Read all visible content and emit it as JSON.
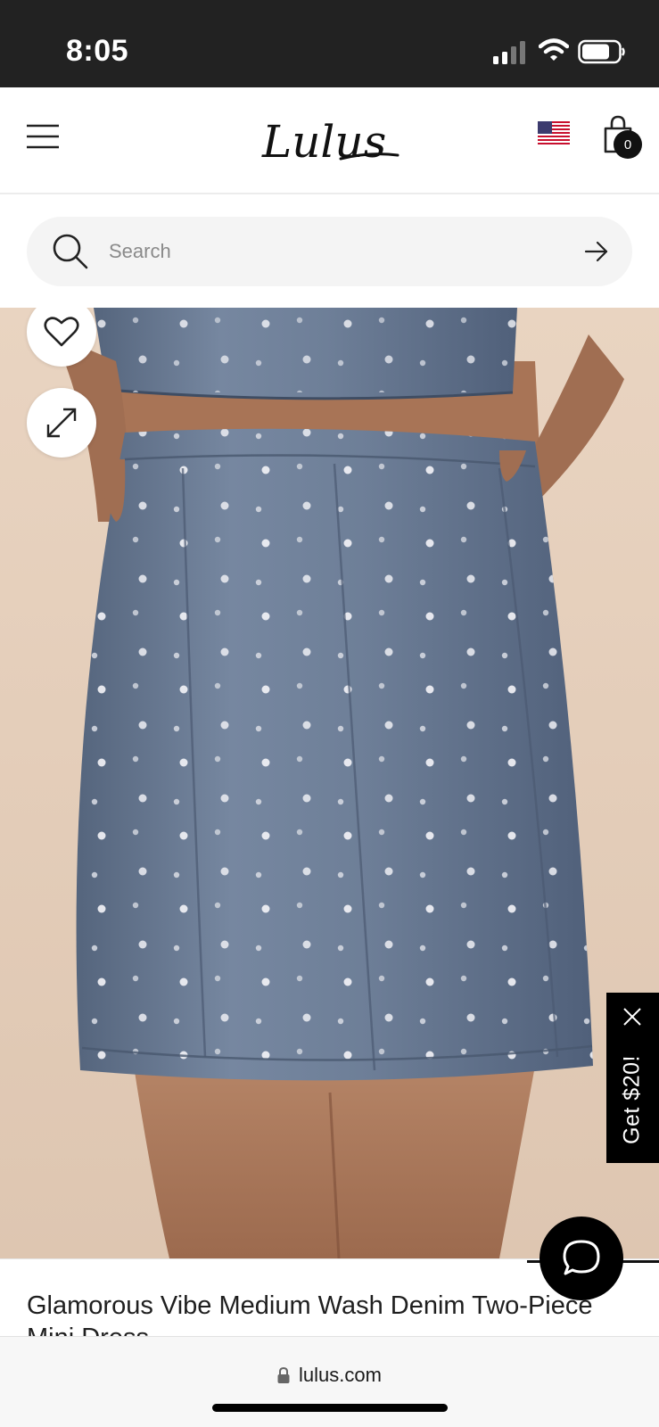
{
  "status_bar": {
    "time": "8:05",
    "icons": [
      "cellular-signal-icon",
      "wifi-icon",
      "battery-icon"
    ]
  },
  "header": {
    "logo_text": "Lulus",
    "icons": [
      "menu-icon",
      "us-flag-icon",
      "shopping-bag-icon"
    ],
    "cart_count": "0"
  },
  "search": {
    "placeholder": "Search",
    "value": ""
  },
  "product_image": {
    "description_icons": [
      "heart-icon",
      "expand-icon"
    ]
  },
  "promo": {
    "label": "Get $20!"
  },
  "product": {
    "title": "Glamorous Vibe Medium Wash Denim Two-Piece Mini Dress"
  },
  "browser": {
    "url": "lulus.com"
  },
  "colors": {
    "status_bar_bg": "#222222",
    "accent": "#000000",
    "search_bg": "#f4f4f4",
    "denim": "#6b7c95"
  }
}
